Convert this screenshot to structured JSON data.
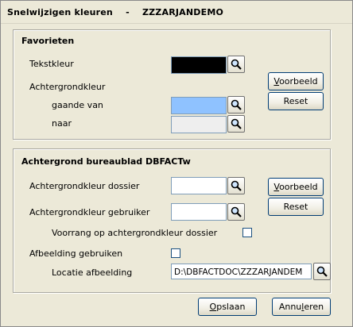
{
  "window": {
    "title": "Snelwijzigen kleuren    -    ZZZARJANDEMO"
  },
  "favorieten": {
    "title": "Favorieten",
    "tekstkleur_label": "Tekstkleur",
    "tekstkleur_color": "#000000",
    "achtergrondkleur_label": "Achtergrondkleur",
    "gaande_van_label": "gaande van",
    "gaande_van_color": "#8fc2ff",
    "naar_label": "naar",
    "naar_color": "#eeeeee",
    "voorbeeld_prefix": "",
    "voorbeeld_underline": "V",
    "voorbeeld_rest": "oorbeeld",
    "reset_label": "Reset"
  },
  "bureaublad": {
    "title": "Achtergrond bureaublad DBFACTw",
    "dossier_label": "Achtergrondkleur dossier",
    "dossier_color": "#ffffff",
    "gebruiker_label": "Achtergrondkleur gebruiker",
    "gebruiker_color": "#ffffff",
    "voorrang_label": "Voorrang op achtergrondkleur dossier",
    "voorrang_checked": false,
    "afbeelding_label": "Afbeelding gebruiken",
    "afbeelding_checked": false,
    "locatie_label": "Locatie afbeelding",
    "locatie_value": "D:\\DBFACTDOC\\ZZZARJANDEM",
    "voorbeeld_underline": "V",
    "voorbeeld_rest": "oorbeeld",
    "reset_label": "Reset"
  },
  "footer": {
    "opslaan_underline": "O",
    "opslaan_rest": "pslaan",
    "annuleren_prefix": "Annu",
    "annuleren_underline": "l",
    "annuleren_rest": "eren"
  },
  "icons": {
    "search": "magnifier-icon"
  }
}
